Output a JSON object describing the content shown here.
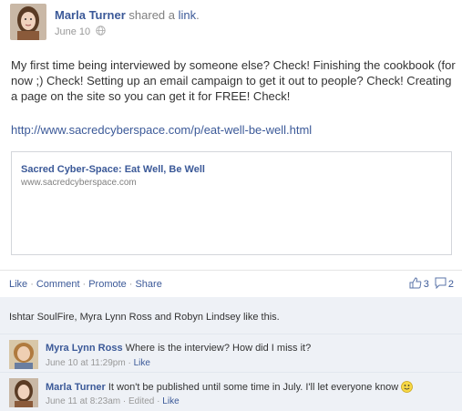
{
  "post": {
    "author": "Marla Turner",
    "action_prefix": "shared a",
    "action_link": "link",
    "action_suffix": ".",
    "date": "June 10",
    "privacy_icon": "globe-icon",
    "body": "My first time being interviewed by someone else? Check! Finishing the cookbook (for now ;) Check! Setting up an email campaign to get it out to people? Check! Creating a page on the site so you can get it for FREE! Check!",
    "url": "http://www.sacredcyberspace.com/p/eat-well-be-well.html",
    "link_card": {
      "title": "Sacred Cyber-Space: Eat Well, Be Well",
      "domain": "www.sacredcyberspace.com"
    }
  },
  "actions": {
    "like": "Like",
    "comment": "Comment",
    "promote": "Promote",
    "share": "Share",
    "separator": "·",
    "like_count": "3",
    "comment_count": "2",
    "like_icon": "thumbs-up-icon",
    "comment_icon": "speech-bubble-icon"
  },
  "likes_summary": "Ishtar SoulFire, Myra Lynn Ross and Robyn Lindsey like this.",
  "comments": [
    {
      "name": "Myra Lynn Ross",
      "text": "Where is the interview? How did I miss it?",
      "time": "June 10 at 11:29pm",
      "edited": "",
      "separator": "·",
      "like": "Like"
    },
    {
      "name": "Marla Turner",
      "text": "It won't be published until some time in July. I'll let everyone know",
      "time": "June 11 at 8:23am",
      "edited": "Edited",
      "separator": "·",
      "like": "Like",
      "emoticon": "smiley-icon"
    }
  ],
  "colors": {
    "link": "#3b5998",
    "comment_bg": "#eef1f6",
    "meta_gray": "#999999"
  }
}
